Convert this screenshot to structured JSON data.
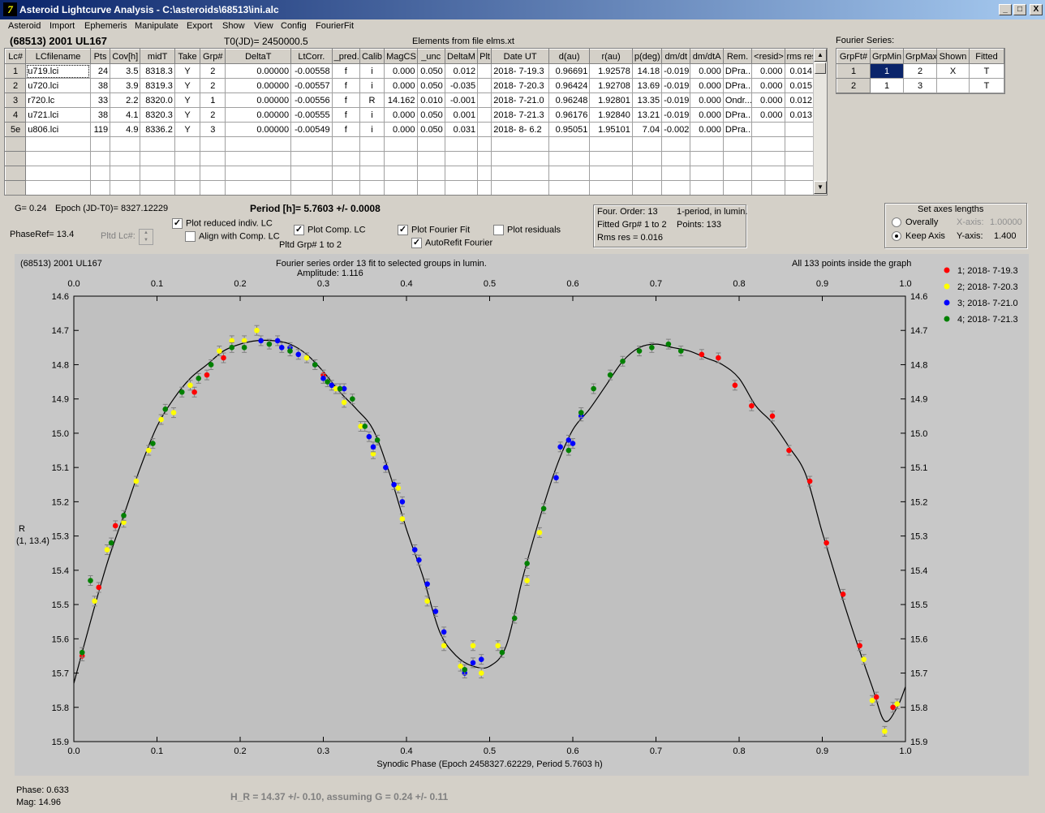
{
  "window": {
    "title": "Asteroid Lightcurve Analysis - C:\\asteroids\\68513\\ini.alc",
    "icon": "app-icon",
    "buttons": [
      "_",
      "□",
      "X"
    ]
  },
  "menu": [
    "Asteroid",
    "Import",
    "Ephemeris",
    "Manipulate",
    "Export",
    "Show",
    "View",
    "Config",
    "FourierFit"
  ],
  "header": {
    "object": "(68513) 2001 UL167",
    "t0": "T0(JD)= 2450000.5",
    "elements": "Elements from file elms.xt"
  },
  "table": {
    "columns": [
      "Lc#",
      "LCfilename",
      "Pts",
      "Cov[h]",
      "midT",
      "Take",
      "Grp#",
      "DeltaT",
      "LtCorr.",
      "_pred.",
      "Calib",
      "MagCS",
      "_unc",
      "DeltaM",
      "Plt",
      "Date UT",
      "d(au)",
      "r(au)",
      "p(deg)",
      "dm/dt",
      "dm/dtA",
      "Rem.",
      "<resid>",
      "rms res"
    ],
    "rows": [
      [
        "1",
        "u719.lci",
        "24",
        "3.5",
        "8318.3",
        "Y",
        "2",
        "0.00000",
        "-0.00558",
        "f",
        "i",
        "0.000",
        "0.050",
        "0.012",
        "",
        "2018- 7-19.3",
        "0.96691",
        "1.92578",
        "14.18",
        "-0.019",
        "0.000",
        "DPra...",
        "0.000",
        "0.014"
      ],
      [
        "2",
        "u720.lci",
        "38",
        "3.9",
        "8319.3",
        "Y",
        "2",
        "0.00000",
        "-0.00557",
        "f",
        "i",
        "0.000",
        "0.050",
        "-0.035",
        "",
        "2018- 7-20.3",
        "0.96424",
        "1.92708",
        "13.69",
        "-0.019",
        "0.000",
        "DPra...",
        "0.000",
        "0.015"
      ],
      [
        "3",
        "r720.lc",
        "33",
        "2.2",
        "8320.0",
        "Y",
        "1",
        "0.00000",
        "-0.00556",
        "f",
        "R",
        "14.162",
        "0.010",
        "-0.001",
        "",
        "2018- 7-21.0",
        "0.96248",
        "1.92801",
        "13.35",
        "-0.019",
        "0.000",
        "Ondr...",
        "0.000",
        "0.012"
      ],
      [
        "4",
        "u721.lci",
        "38",
        "4.1",
        "8320.3",
        "Y",
        "2",
        "0.00000",
        "-0.00555",
        "f",
        "i",
        "0.000",
        "0.050",
        "0.001",
        "",
        "2018- 7-21.3",
        "0.96176",
        "1.92840",
        "13.21",
        "-0.019",
        "0.000",
        "DPra...",
        "0.000",
        "0.013"
      ],
      [
        "5e",
        "u806.lci",
        "119",
        "4.9",
        "8336.2",
        "Y",
        "3",
        "0.00000",
        "-0.00549",
        "f",
        "i",
        "0.000",
        "0.050",
        "0.031",
        "",
        "2018- 8- 6.2",
        "0.95051",
        "1.95101",
        "7.04",
        "-0.002",
        "0.000",
        "DPra...",
        "",
        ""
      ]
    ]
  },
  "fourier_table": {
    "title": "Fourier Series:",
    "columns": [
      "GrpFt#",
      "GrpMin",
      "GrpMax",
      "Shown",
      "Fitted"
    ],
    "rows": [
      [
        "1",
        "1",
        "2",
        "X",
        "T"
      ],
      [
        "2",
        "1",
        "3",
        "",
        "T"
      ]
    ]
  },
  "params": {
    "g": "G= 0.24",
    "epoch": "Epoch (JD-T0)= 8327.12229",
    "period": "Period [h]= 5.7603 +/- 0.0008",
    "phaseref": "PhaseRef= 13.4",
    "pltd_lc": "Pltd Lc#:",
    "pltd_grp": "Pltd Grp#  1   to   2"
  },
  "options": {
    "reduced": "Plot reduced indiv. LC",
    "align": "Align with Comp. LC",
    "comp": "Plot Comp. LC",
    "fourier": "Plot Fourier Fit",
    "residuals": "Plot residuals",
    "autorefit": "AutoRefit Fourier"
  },
  "fit_info": {
    "order": "Four. Order: 13",
    "period_type": "1-period, in lumin.",
    "fitted": "Fitted Grp# 1 to 2",
    "points": "Points: 133",
    "rms": "Rms res     = 0.016"
  },
  "axes_box": {
    "title": "Set axes lengths",
    "overally": "Overally",
    "keep": "Keep Axis",
    "xlabel": "X-axis:",
    "xval": "1.00000",
    "ylabel": "Y-axis:",
    "yval": "1.400"
  },
  "plot": {
    "corner": "(68513) 2001 UL167",
    "caption1": "Fourier series order 13 fit to selected groups in lumin.",
    "caption2": "Amplitude: 1.116",
    "inside": "All 133 points inside the graph",
    "ylabel1": "R",
    "ylabel2": "(1, 13.4)"
  },
  "status": {
    "phase": "Phase:  0.633",
    "mag": "Mag:     14.96",
    "hr": "H_R = 14.37 +/- 0.10, assuming G = 0.24 +/- 0.11"
  },
  "chart_data": {
    "type": "scatter",
    "xlabel": "Synodic Phase (Epoch 2458327.62229, Period 5.7603 h)",
    "ylabel": "R",
    "xlim": [
      0.0,
      1.0
    ],
    "ylim": [
      15.9,
      14.6
    ],
    "xticks": [
      "0.0",
      "0.1",
      "0.2",
      "0.3",
      "0.4",
      "0.5",
      "0.6",
      "0.7",
      "0.8",
      "0.9",
      "1.0"
    ],
    "yticks": [
      "14.6",
      "14.7",
      "14.8",
      "14.9",
      "15.0",
      "15.1",
      "15.2",
      "15.3",
      "15.4",
      "15.5",
      "15.6",
      "15.7",
      "15.8",
      "15.9"
    ],
    "fit_line": [
      [
        0.0,
        15.73
      ],
      [
        0.02,
        15.55
      ],
      [
        0.04,
        15.38
      ],
      [
        0.06,
        15.24
      ],
      [
        0.08,
        15.1
      ],
      [
        0.1,
        14.98
      ],
      [
        0.12,
        14.9
      ],
      [
        0.14,
        14.84
      ],
      [
        0.16,
        14.8
      ],
      [
        0.18,
        14.76
      ],
      [
        0.2,
        14.74
      ],
      [
        0.22,
        14.73
      ],
      [
        0.24,
        14.73
      ],
      [
        0.26,
        14.74
      ],
      [
        0.28,
        14.77
      ],
      [
        0.3,
        14.82
      ],
      [
        0.32,
        14.88
      ],
      [
        0.34,
        14.93
      ],
      [
        0.36,
        14.99
      ],
      [
        0.38,
        15.12
      ],
      [
        0.4,
        15.28
      ],
      [
        0.42,
        15.42
      ],
      [
        0.44,
        15.58
      ],
      [
        0.46,
        15.65
      ],
      [
        0.48,
        15.68
      ],
      [
        0.5,
        15.68
      ],
      [
        0.52,
        15.62
      ],
      [
        0.54,
        15.42
      ],
      [
        0.56,
        15.25
      ],
      [
        0.58,
        15.1
      ],
      [
        0.6,
        14.99
      ],
      [
        0.62,
        14.93
      ],
      [
        0.64,
        14.86
      ],
      [
        0.66,
        14.79
      ],
      [
        0.68,
        14.75
      ],
      [
        0.7,
        14.74
      ],
      [
        0.72,
        14.75
      ],
      [
        0.74,
        14.76
      ],
      [
        0.76,
        14.78
      ],
      [
        0.78,
        14.8
      ],
      [
        0.8,
        14.84
      ],
      [
        0.82,
        14.92
      ],
      [
        0.84,
        14.97
      ],
      [
        0.86,
        15.04
      ],
      [
        0.88,
        15.12
      ],
      [
        0.9,
        15.29
      ],
      [
        0.92,
        15.45
      ],
      [
        0.94,
        15.6
      ],
      [
        0.96,
        15.74
      ],
      [
        0.975,
        15.84
      ],
      [
        0.99,
        15.8
      ],
      [
        1.0,
        15.74
      ]
    ],
    "series": [
      {
        "name": "1; 2018- 7-19.3",
        "color": "#ff0000",
        "points": [
          [
            0.01,
            15.65
          ],
          [
            0.03,
            15.45
          ],
          [
            0.05,
            15.27
          ],
          [
            0.145,
            14.88
          ],
          [
            0.16,
            14.83
          ],
          [
            0.18,
            14.78
          ],
          [
            0.3,
            14.83
          ],
          [
            0.755,
            14.77
          ],
          [
            0.775,
            14.78
          ],
          [
            0.795,
            14.86
          ],
          [
            0.815,
            14.92
          ],
          [
            0.84,
            14.95
          ],
          [
            0.86,
            15.05
          ],
          [
            0.885,
            15.14
          ],
          [
            0.905,
            15.32
          ],
          [
            0.925,
            15.47
          ],
          [
            0.945,
            15.62
          ],
          [
            0.965,
            15.77
          ],
          [
            0.985,
            15.8
          ]
        ]
      },
      {
        "name": "2; 2018- 7-20.3",
        "color": "#ffff00",
        "points": [
          [
            0.025,
            15.49
          ],
          [
            0.04,
            15.34
          ],
          [
            0.06,
            15.26
          ],
          [
            0.075,
            15.14
          ],
          [
            0.09,
            15.05
          ],
          [
            0.105,
            14.96
          ],
          [
            0.12,
            14.94
          ],
          [
            0.14,
            14.86
          ],
          [
            0.175,
            14.76
          ],
          [
            0.19,
            14.73
          ],
          [
            0.205,
            14.73
          ],
          [
            0.22,
            14.7
          ],
          [
            0.28,
            14.78
          ],
          [
            0.315,
            14.87
          ],
          [
            0.325,
            14.91
          ],
          [
            0.345,
            14.98
          ],
          [
            0.36,
            15.06
          ],
          [
            0.39,
            15.16
          ],
          [
            0.395,
            15.25
          ],
          [
            0.425,
            15.49
          ],
          [
            0.445,
            15.62
          ],
          [
            0.465,
            15.68
          ],
          [
            0.48,
            15.62
          ],
          [
            0.49,
            15.7
          ],
          [
            0.51,
            15.62
          ],
          [
            0.545,
            15.43
          ],
          [
            0.56,
            15.29
          ],
          [
            0.95,
            15.66
          ],
          [
            0.96,
            15.78
          ],
          [
            0.975,
            15.87
          ],
          [
            0.99,
            15.79
          ]
        ]
      },
      {
        "name": "3; 2018- 7-21.0",
        "color": "#0000ff",
        "points": [
          [
            0.225,
            14.73
          ],
          [
            0.245,
            14.73
          ],
          [
            0.25,
            14.75
          ],
          [
            0.26,
            14.75
          ],
          [
            0.27,
            14.77
          ],
          [
            0.29,
            14.8
          ],
          [
            0.3,
            14.84
          ],
          [
            0.31,
            14.86
          ],
          [
            0.325,
            14.87
          ],
          [
            0.355,
            15.01
          ],
          [
            0.36,
            15.04
          ],
          [
            0.375,
            15.1
          ],
          [
            0.385,
            15.15
          ],
          [
            0.395,
            15.2
          ],
          [
            0.41,
            15.34
          ],
          [
            0.415,
            15.37
          ],
          [
            0.425,
            15.44
          ],
          [
            0.435,
            15.52
          ],
          [
            0.445,
            15.58
          ],
          [
            0.47,
            15.7
          ],
          [
            0.48,
            15.67
          ],
          [
            0.49,
            15.66
          ],
          [
            0.58,
            15.13
          ],
          [
            0.585,
            15.04
          ],
          [
            0.595,
            15.02
          ],
          [
            0.6,
            15.03
          ],
          [
            0.61,
            14.95
          ]
        ]
      },
      {
        "name": "4; 2018- 7-21.3",
        "color": "#008000",
        "points": [
          [
            0.01,
            15.64
          ],
          [
            0.02,
            15.43
          ],
          [
            0.045,
            15.32
          ],
          [
            0.06,
            15.24
          ],
          [
            0.095,
            15.03
          ],
          [
            0.11,
            14.93
          ],
          [
            0.13,
            14.88
          ],
          [
            0.15,
            14.84
          ],
          [
            0.165,
            14.8
          ],
          [
            0.19,
            14.75
          ],
          [
            0.205,
            14.75
          ],
          [
            0.235,
            14.74
          ],
          [
            0.26,
            14.76
          ],
          [
            0.29,
            14.8
          ],
          [
            0.305,
            14.85
          ],
          [
            0.32,
            14.87
          ],
          [
            0.335,
            14.9
          ],
          [
            0.35,
            14.98
          ],
          [
            0.365,
            15.02
          ],
          [
            0.47,
            15.69
          ],
          [
            0.515,
            15.64
          ],
          [
            0.53,
            15.54
          ],
          [
            0.545,
            15.38
          ],
          [
            0.565,
            15.22
          ],
          [
            0.595,
            15.05
          ],
          [
            0.61,
            14.94
          ],
          [
            0.625,
            14.87
          ],
          [
            0.645,
            14.83
          ],
          [
            0.66,
            14.79
          ],
          [
            0.68,
            14.76
          ],
          [
            0.695,
            14.75
          ],
          [
            0.715,
            14.74
          ],
          [
            0.73,
            14.76
          ]
        ]
      }
    ],
    "legend_position": "top-right"
  }
}
